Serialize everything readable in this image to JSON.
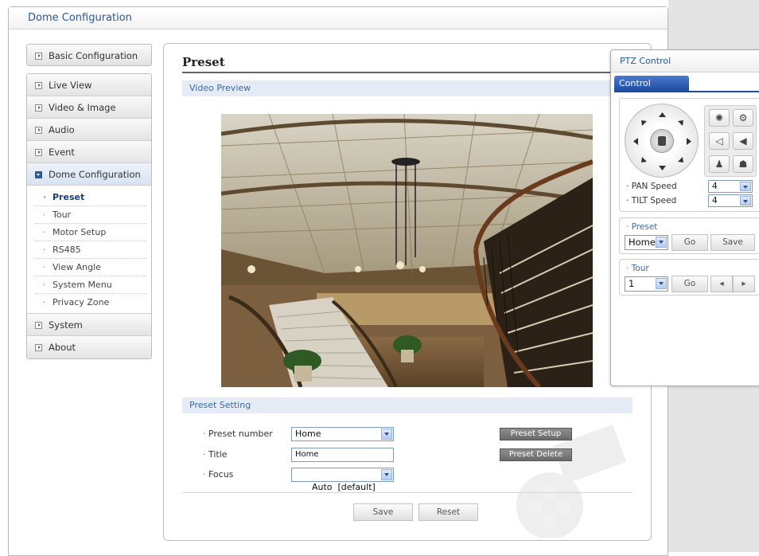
{
  "window": {
    "title": "Dome Configuration"
  },
  "sidebar": {
    "basic_config": "Basic Configuration",
    "items": [
      {
        "label": "Live View"
      },
      {
        "label": "Video & Image"
      },
      {
        "label": "Audio"
      },
      {
        "label": "Event"
      },
      {
        "label": "Dome Configuration",
        "expanded": true
      }
    ],
    "subitems": [
      {
        "label": "Preset",
        "active": true
      },
      {
        "label": "Tour"
      },
      {
        "label": "Motor Setup"
      },
      {
        "label": "RS485"
      },
      {
        "label": "View Angle"
      },
      {
        "label": "System Menu"
      },
      {
        "label": "Privacy Zone"
      }
    ],
    "bottom_items": [
      {
        "label": "System"
      },
      {
        "label": "About"
      }
    ]
  },
  "main": {
    "title": "Preset",
    "video_section": "Video Preview",
    "setting_section": "Preset Setting",
    "fields": {
      "preset_number_label": "Preset number",
      "preset_number_value": "Home",
      "title_label": "Title",
      "title_value": "Home",
      "focus_label": "Focus",
      "focus_value": "Auto  [default]"
    },
    "preset_setup_button": "Preset Setup",
    "preset_delete_button": "Preset Delete",
    "save_button": "Save",
    "reset_button": "Reset"
  },
  "ptz": {
    "title": "PTZ Control",
    "tab_control": "Control",
    "pan_speed_label": "PAN Speed",
    "pan_speed_value": "4",
    "tilt_speed_label": "TILT Speed",
    "tilt_speed_value": "4",
    "preset_heading": "Preset",
    "preset_value": "Home",
    "preset_go": "Go",
    "preset_save": "Save",
    "tour_heading": "Tour",
    "tour_value": "1",
    "tour_go": "Go",
    "tour_prev_icon": "◂",
    "tour_next_icon": "▸"
  },
  "colors": {
    "accent_blue": "#2a5a9a",
    "tab_blue": "#1e4ea2",
    "section_bg": "#e5ecf6"
  }
}
